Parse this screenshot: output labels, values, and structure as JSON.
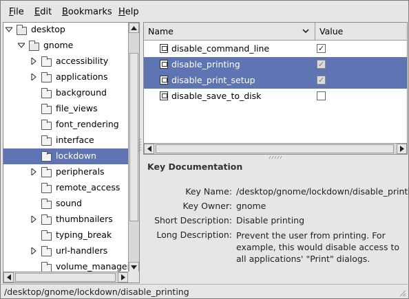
{
  "menu": [
    {
      "label": "File",
      "mnemonic": "F",
      "rest": "ile"
    },
    {
      "label": "Edit",
      "mnemonic": "E",
      "rest": "dit"
    },
    {
      "label": "Bookmarks",
      "mnemonic": "B",
      "rest": "ookmarks"
    },
    {
      "label": "Help",
      "mnemonic": "H",
      "rest": "elp"
    }
  ],
  "tree": {
    "items": [
      {
        "label": "desktop",
        "level": 0,
        "expander": "expanded",
        "folder": "open"
      },
      {
        "label": "gnome",
        "level": 1,
        "expander": "expanded",
        "folder": "open"
      },
      {
        "label": "accessibility",
        "level": 2,
        "expander": "collapsed",
        "folder": "closed"
      },
      {
        "label": "applications",
        "level": 2,
        "expander": "collapsed",
        "folder": "closed"
      },
      {
        "label": "background",
        "level": 2,
        "expander": "none",
        "folder": "closed"
      },
      {
        "label": "file_views",
        "level": 2,
        "expander": "none",
        "folder": "closed"
      },
      {
        "label": "font_rendering",
        "level": 2,
        "expander": "none",
        "folder": "closed"
      },
      {
        "label": "interface",
        "level": 2,
        "expander": "none",
        "folder": "closed"
      },
      {
        "label": "lockdown",
        "level": 2,
        "expander": "none",
        "folder": "closed",
        "selected": true
      },
      {
        "label": "peripherals",
        "level": 2,
        "expander": "collapsed",
        "folder": "closed"
      },
      {
        "label": "remote_access",
        "level": 2,
        "expander": "none",
        "folder": "closed"
      },
      {
        "label": "sound",
        "level": 2,
        "expander": "none",
        "folder": "closed"
      },
      {
        "label": "thumbnailers",
        "level": 2,
        "expander": "collapsed",
        "folder": "closed"
      },
      {
        "label": "typing_break",
        "level": 2,
        "expander": "none",
        "folder": "closed"
      },
      {
        "label": "url-handlers",
        "level": 2,
        "expander": "collapsed",
        "folder": "closed"
      },
      {
        "label": "volume_manager",
        "level": 2,
        "expander": "none",
        "folder": "closed"
      }
    ]
  },
  "keys": {
    "columns": {
      "name": "Name",
      "value": "Value"
    },
    "rows": [
      {
        "name": "disable_command_line",
        "checked": true,
        "selected": false
      },
      {
        "name": "disable_printing",
        "checked": true,
        "selected": true
      },
      {
        "name": "disable_print_setup",
        "checked": true,
        "selected": true
      },
      {
        "name": "disable_save_to_disk",
        "checked": false,
        "selected": false
      }
    ]
  },
  "doc": {
    "title": "Key Documentation",
    "key_name_label": "Key Name:",
    "key_name": "/desktop/gnome/lockdown/disable_printing",
    "key_owner_label": "Key Owner:",
    "key_owner": "gnome",
    "short_desc_label": "Short Description:",
    "short_desc": "Disable printing",
    "long_desc_label": "Long Description:",
    "long_desc": "Prevent the user from printing. For example, this would disable access to all applications' \"Print\" dialogs."
  },
  "status": {
    "path": "/desktop/gnome/lockdown/disable_printing"
  },
  "colors": {
    "selection": "#5f74b2",
    "background": "#e6e6e6"
  }
}
